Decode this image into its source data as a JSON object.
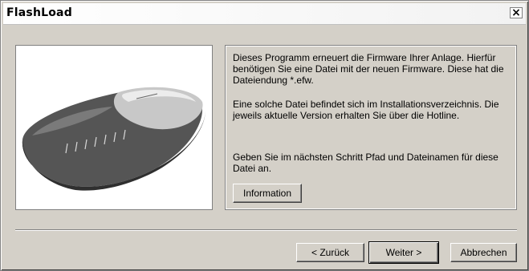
{
  "window": {
    "title": "FlashLoad",
    "close_label": "×"
  },
  "image": {
    "alt": "router-photo"
  },
  "panel": {
    "p1": "Dieses Programm erneuert die Firmware Ihrer Anlage. Hierfür benötigen Sie eine Datei mit der neuen Firmware. Diese hat die Dateiendung *.efw.",
    "p2": "Eine solche Datei befindet sich im Installationsverzeichnis. Die jeweils aktuelle Version erhalten Sie über die Hotline.",
    "p3": "Geben Sie im nächsten Schritt Pfad und Dateinamen für diese Datei an.",
    "info_button": "Information"
  },
  "buttons": {
    "back": "< Zurück",
    "next": "Weiter >",
    "cancel": "Abbrechen"
  }
}
